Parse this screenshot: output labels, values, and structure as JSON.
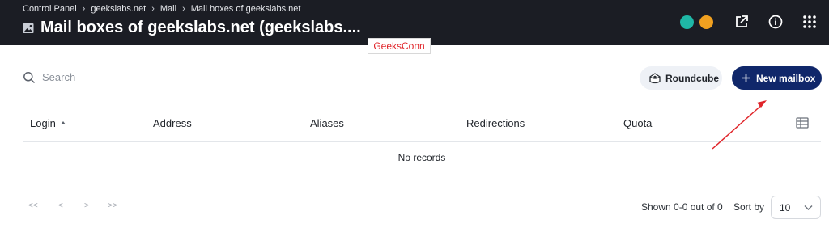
{
  "breadcrumb": [
    "Control Panel",
    "geekslabs.net",
    "Mail",
    "Mail boxes of geekslabs.net"
  ],
  "page_title": "Mail boxes of geekslabs.net (geekslabs....",
  "watermark": "GeeksConn",
  "search": {
    "placeholder": "Search"
  },
  "buttons": {
    "roundcube": "Roundcube",
    "new_mailbox": "New mailbox"
  },
  "table": {
    "columns": [
      "Login",
      "Address",
      "Aliases",
      "Redirections",
      "Quota"
    ],
    "empty_text": "No records"
  },
  "pagination": {
    "first": "<<",
    "prev": "<",
    "next": ">",
    "last": ">>"
  },
  "footer": {
    "shown": "Shown 0-0 out of 0",
    "sort_by_label": "Sort by",
    "page_size": "10"
  },
  "icons": {
    "header": [
      "image-icon",
      "status-teal-icon",
      "status-orange-icon",
      "external-link-icon",
      "info-icon",
      "grid-menu-icon"
    ],
    "content": [
      "search-icon",
      "roundcube-icon",
      "plus-icon",
      "sort-asc-icon",
      "columns-icon",
      "chevron-down-icon"
    ]
  },
  "colors": {
    "header_bg": "#1b1d24",
    "primary": "#10276a",
    "annotation_arrow": "#e0252a",
    "teal": "#1fb7a6",
    "orange": "#f0a020"
  }
}
